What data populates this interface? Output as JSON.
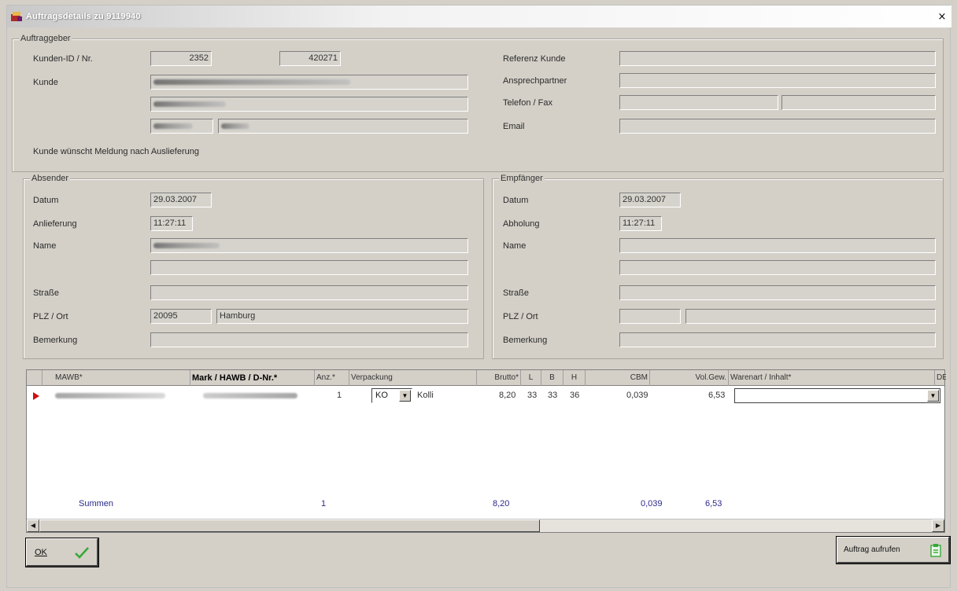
{
  "window": {
    "title": "Auftragsdetails zu 9119940",
    "close_glyph": "×"
  },
  "auftraggeber": {
    "legend": "Auftraggeber",
    "kunden_id_label": "Kunden-ID / Nr.",
    "kunden_id": "2352",
    "kunden_nr": "420271",
    "kunde_label": "Kunde",
    "referenz_label": "Referenz Kunde",
    "ansprech_label": "Ansprechpartner",
    "telefon_label": "Telefon / Fax",
    "email_label": "Email",
    "meldung_text": "Kunde wünscht Meldung nach Auslieferung"
  },
  "absender": {
    "legend": "Absender",
    "datum_label": "Datum",
    "datum": "29.03.2007",
    "anlieferung_label": "Anlieferung",
    "anlieferung": "11:27:11",
    "name_label": "Name",
    "strasse_label": "Straße",
    "plz_label": "PLZ / Ort",
    "plz": "20095",
    "ort": "Hamburg",
    "bemerkung_label": "Bemerkung"
  },
  "empfaenger": {
    "legend": "Empfänger",
    "datum_label": "Datum",
    "datum": "29.03.2007",
    "abholung_label": "Abholung",
    "abholung": "11:27:11",
    "name_label": "Name",
    "strasse_label": "Straße",
    "plz_label": "PLZ / Ort",
    "bemerkung_label": "Bemerkung"
  },
  "grid": {
    "headers": {
      "mawb": "MAWB*",
      "mark": "Mark / HAWB / D-Nr.*",
      "anz": "Anz.*",
      "verpackung": "Verpackung",
      "brutto": "Brutto*",
      "l": "L",
      "b": "B",
      "h": "H",
      "cbm": "CBM",
      "volgew": "Vol.Gew.",
      "warenart": "Warenart / Inhalt*",
      "de": "DE"
    },
    "row": {
      "anz": "1",
      "verp_code": "KO",
      "verp_text": "Kolli",
      "brutto": "8,20",
      "l": "33",
      "b": "33",
      "h": "36",
      "cbm": "0,039",
      "volgew": "6,53",
      "warenart": ""
    },
    "summen": {
      "label": "Summen",
      "anz": "1",
      "brutto": "8,20",
      "cbm": "0,039",
      "volgew": "6,53"
    }
  },
  "buttons": {
    "ok": "OK",
    "auftrag": "Auftrag aufrufen"
  }
}
